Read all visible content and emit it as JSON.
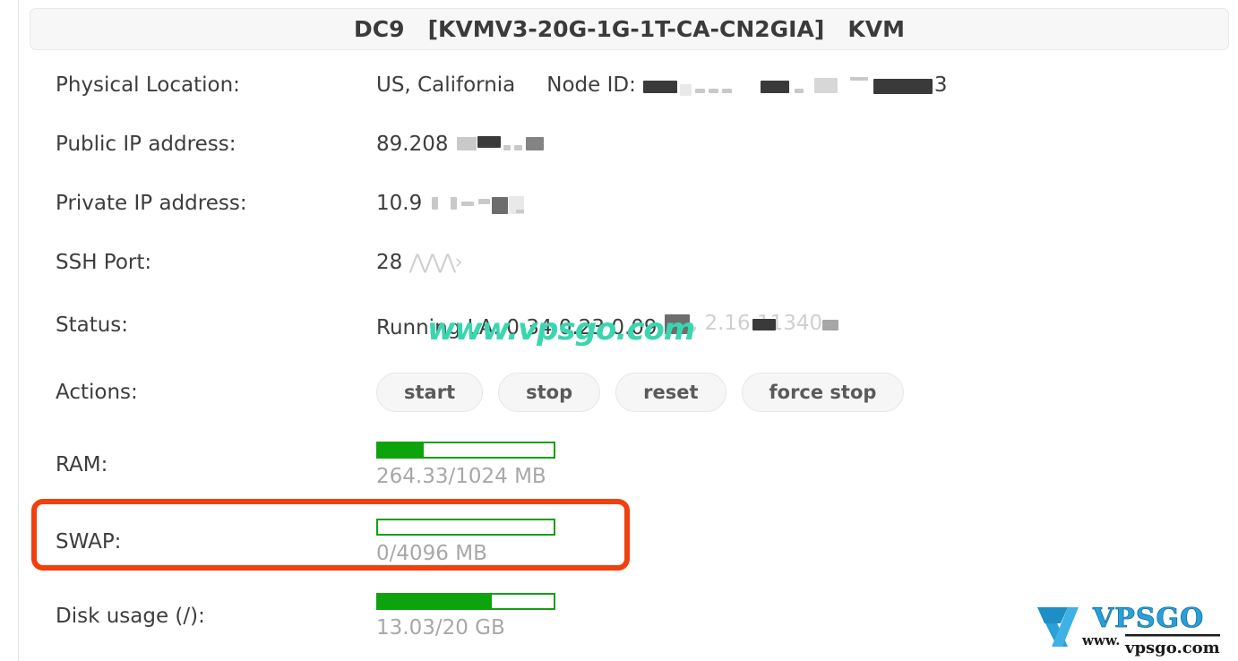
{
  "header": {
    "title": "DC9   [KVMV3-20G-1G-1T-CA-CN2GIA]   KVM"
  },
  "rows": {
    "physical_location": {
      "label": "Physical Location:",
      "value": "US, California",
      "node_id_label": "Node ID:",
      "node_id_value_visible_tail": "3",
      "node_id_redacted": true
    },
    "public_ip": {
      "label": "Public IP address:",
      "value_visible_prefix": "89.208",
      "redacted": true
    },
    "private_ip": {
      "label": "Private IP address:",
      "value_visible_prefix": "10.9",
      "redacted": true
    },
    "ssh_port": {
      "label": "SSH Port:",
      "value_visible_prefix": "28",
      "redacted": true
    },
    "status": {
      "label": "Status:",
      "value": "Running  LA: 0.34 0.23 0.09",
      "redacted_tail": true
    },
    "actions": {
      "label": "Actions:",
      "buttons": [
        {
          "name": "start",
          "label": "start"
        },
        {
          "name": "stop",
          "label": "stop"
        },
        {
          "name": "reset",
          "label": "reset"
        },
        {
          "name": "force-stop",
          "label": "force stop"
        }
      ]
    },
    "ram": {
      "label": "RAM:",
      "text": "264.33/1024 MB",
      "used": 264.33,
      "total": 1024,
      "unit": "MB",
      "percent": 26
    },
    "swap": {
      "label": "SWAP:",
      "text": "0/4096 MB",
      "used": 0,
      "total": 4096,
      "unit": "MB",
      "percent": 0,
      "highlighted": true
    },
    "disk": {
      "label": "Disk usage (/):",
      "text": "13.03/20 GB",
      "used": 13.03,
      "total": 20,
      "unit": "GB",
      "percent": 65
    }
  },
  "watermark": {
    "text": "www.vpsgo.com"
  },
  "logo": {
    "brand": "VPSGO",
    "www": "www.",
    "domain": "vpsgo.com"
  },
  "colors": {
    "meter_green": "#0ba50b",
    "meter_border": "#12a012",
    "highlight_red": "#f1400d",
    "watermark_teal": "#3ad6b0",
    "logo_blue": "#2a9fd8",
    "header_bg": "#f7f7f7",
    "muted_text": "#a8a8a8"
  }
}
